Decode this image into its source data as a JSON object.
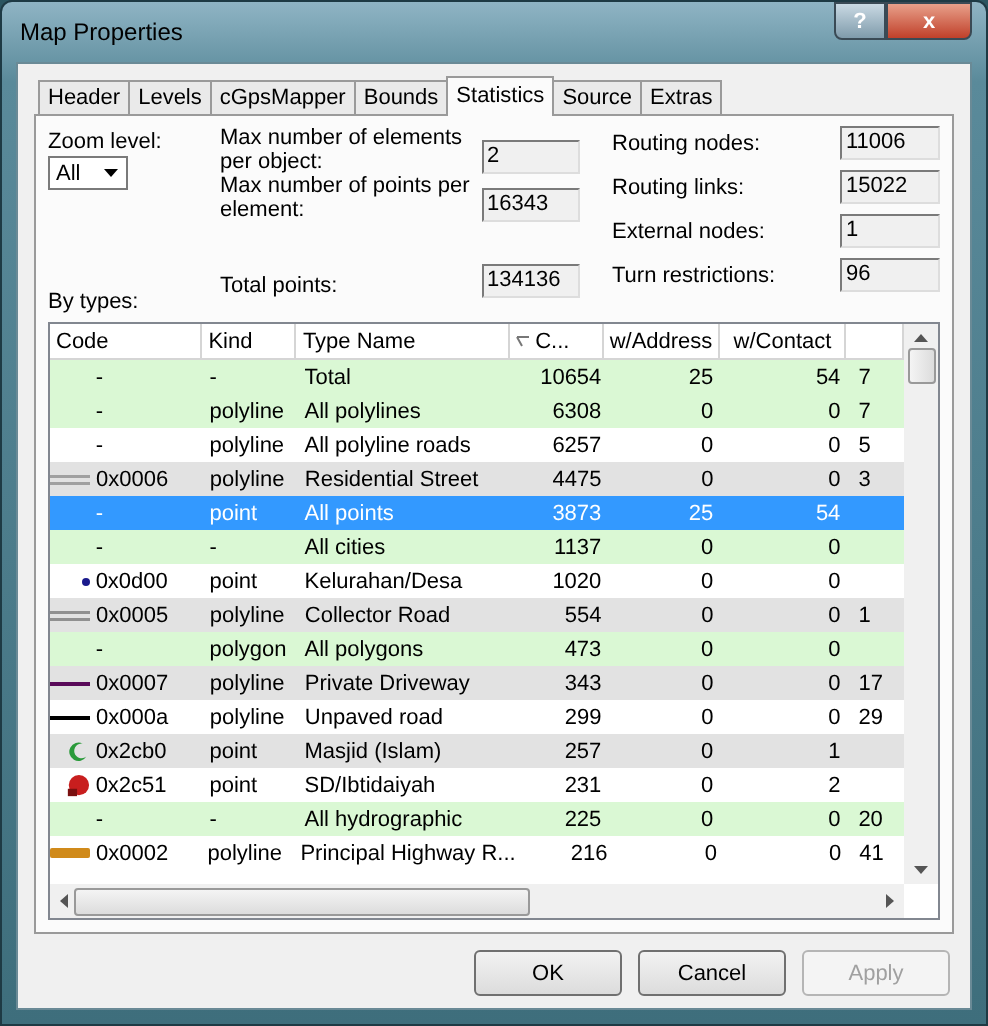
{
  "window": {
    "title": "Map Properties",
    "help": "?",
    "close": "x"
  },
  "tabs": [
    {
      "label": "Header",
      "selected": false
    },
    {
      "label": "Levels",
      "selected": false
    },
    {
      "label": "cGpsMapper",
      "selected": false
    },
    {
      "label": "Bounds",
      "selected": false
    },
    {
      "label": "Statistics",
      "selected": true
    },
    {
      "label": "Source",
      "selected": false
    },
    {
      "label": "Extras",
      "selected": false
    }
  ],
  "zoom_level": {
    "label": "Zoom level:",
    "value": "All"
  },
  "stats_left": [
    {
      "label": "Max number of elements per object:",
      "value": "2"
    },
    {
      "label": "Max number of points per element:",
      "value": "16343"
    },
    {
      "label": "Total points:",
      "value": "134136"
    }
  ],
  "stats_right": [
    {
      "label": "Routing nodes:",
      "value": "11006"
    },
    {
      "label": "Routing links:",
      "value": "15022"
    },
    {
      "label": "External nodes:",
      "value": "1"
    },
    {
      "label": "Turn restrictions:",
      "value": "96"
    }
  ],
  "by_types_label": "By types:",
  "table": {
    "columns": [
      "Code",
      "Kind",
      "Type Name",
      "C...",
      "w/Address",
      "w/Contact"
    ],
    "rows": [
      {
        "kind": "summary",
        "selected": false,
        "code": "-",
        "type_kind": "-",
        "name": "Total",
        "count": "10654",
        "address": "25",
        "contact": "54",
        "column_7": "7"
      },
      {
        "kind": "summary",
        "selected": false,
        "code": "-",
        "type_kind": "polyline",
        "name": "All polylines",
        "count": "6308",
        "address": "0",
        "contact": "0",
        "column_7": "7"
      },
      {
        "kind": "plain",
        "selected": false,
        "code": "-",
        "type_kind": "polyline",
        "name": "All polyline roads",
        "count": "6257",
        "address": "0",
        "contact": "0",
        "column_7": "5"
      },
      {
        "kind": "shaded",
        "selected": false,
        "icon": {
          "kind": "double",
          "color": "#a0a0a0"
        },
        "code": "0x0006",
        "type_kind": "polyline",
        "name": "Residential Street",
        "count": "4475",
        "address": "0",
        "contact": "0",
        "column_7": "3"
      },
      {
        "kind": "summary",
        "selected": true,
        "code": "-",
        "type_kind": "point",
        "name": "All points",
        "count": "3873",
        "address": "25",
        "contact": "54"
      },
      {
        "kind": "summary",
        "selected": false,
        "code": "-",
        "type_kind": "-",
        "name": "All cities",
        "count": "1137",
        "address": "0",
        "contact": "0"
      },
      {
        "kind": "plain",
        "selected": false,
        "icon": {
          "kind": "dot",
          "color": "#1a1a8c"
        },
        "code": "0x0d00",
        "type_kind": "point",
        "name": "Kelurahan/Desa",
        "count": "1020",
        "address": "0",
        "contact": "0"
      },
      {
        "kind": "shaded",
        "selected": false,
        "icon": {
          "kind": "double",
          "color": "#909090"
        },
        "code": "0x0005",
        "type_kind": "polyline",
        "name": "Collector Road",
        "count": "554",
        "address": "0",
        "contact": "0",
        "column_7": "1"
      },
      {
        "kind": "summary",
        "selected": false,
        "code": "-",
        "type_kind": "polygon",
        "name": "All polygons",
        "count": "473",
        "address": "0",
        "contact": "0"
      },
      {
        "kind": "shaded",
        "selected": false,
        "icon": {
          "kind": "line",
          "color": "#5a0a5a"
        },
        "code": "0x0007",
        "type_kind": "polyline",
        "name": "Private Driveway",
        "count": "343",
        "address": "0",
        "contact": "0",
        "column_7": "17"
      },
      {
        "kind": "plain",
        "selected": false,
        "icon": {
          "kind": "line",
          "color": "#000000"
        },
        "code": "0x000a",
        "type_kind": "polyline",
        "name": "Unpaved road",
        "count": "299",
        "address": "0",
        "contact": "0",
        "column_7": "29"
      },
      {
        "kind": "shaded",
        "selected": false,
        "icon": {
          "kind": "crescent",
          "color": "#2a9a3a"
        },
        "code": "0x2cb0",
        "type_kind": "point",
        "name": "Masjid (Islam)",
        "count": "257",
        "address": "0",
        "contact": "1"
      },
      {
        "kind": "plain",
        "selected": false,
        "icon": {
          "kind": "school",
          "color": "#c81e1e"
        },
        "code": "0x2c51",
        "type_kind": "point",
        "name": "SD/Ibtidaiyah",
        "count": "231",
        "address": "0",
        "contact": "2"
      },
      {
        "kind": "summary",
        "selected": false,
        "code": "-",
        "type_kind": "-",
        "name": "All hydrographic",
        "count": "225",
        "address": "0",
        "contact": "0",
        "column_7": "20"
      },
      {
        "kind": "plain",
        "selected": false,
        "icon": {
          "kind": "thick",
          "color": "#d08a1a"
        },
        "code": "0x0002",
        "type_kind": "polyline",
        "name": "Principal Highway R...",
        "count": "216",
        "address": "0",
        "contact": "0",
        "column_7": "41"
      }
    ]
  },
  "buttons": [
    {
      "label": "OK",
      "disabled": false
    },
    {
      "label": "Cancel",
      "disabled": false
    },
    {
      "label": "Apply",
      "disabled": true
    }
  ]
}
